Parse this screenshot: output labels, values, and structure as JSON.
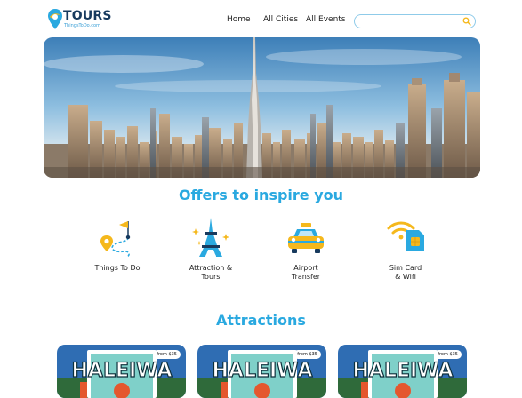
{
  "logo": {
    "word": "TOURS",
    "sub": "ThingsToDo.com"
  },
  "nav": {
    "home": "Home",
    "cities": "All Cities",
    "events": "All Events"
  },
  "search": {
    "placeholder": ""
  },
  "offers": {
    "title": "Offers to inspire you",
    "items": [
      {
        "label": "Things To Do",
        "icon": "route-map-icon"
      },
      {
        "label": "Attraction &\nTours",
        "icon": "eiffel-tower-icon"
      },
      {
        "label": "Airport\nTransfer",
        "icon": "taxi-icon"
      },
      {
        "label": "Sim Card\n& Wifi",
        "icon": "sim-wifi-icon"
      }
    ]
  },
  "attractions": {
    "title": "Attractions",
    "cards": [
      {
        "price": "from $35"
      },
      {
        "price": "from $35"
      },
      {
        "price": "from $35"
      }
    ]
  },
  "colors": {
    "accent": "#2aa9e0",
    "navy": "#173a5e",
    "yellow": "#f5b81c"
  }
}
